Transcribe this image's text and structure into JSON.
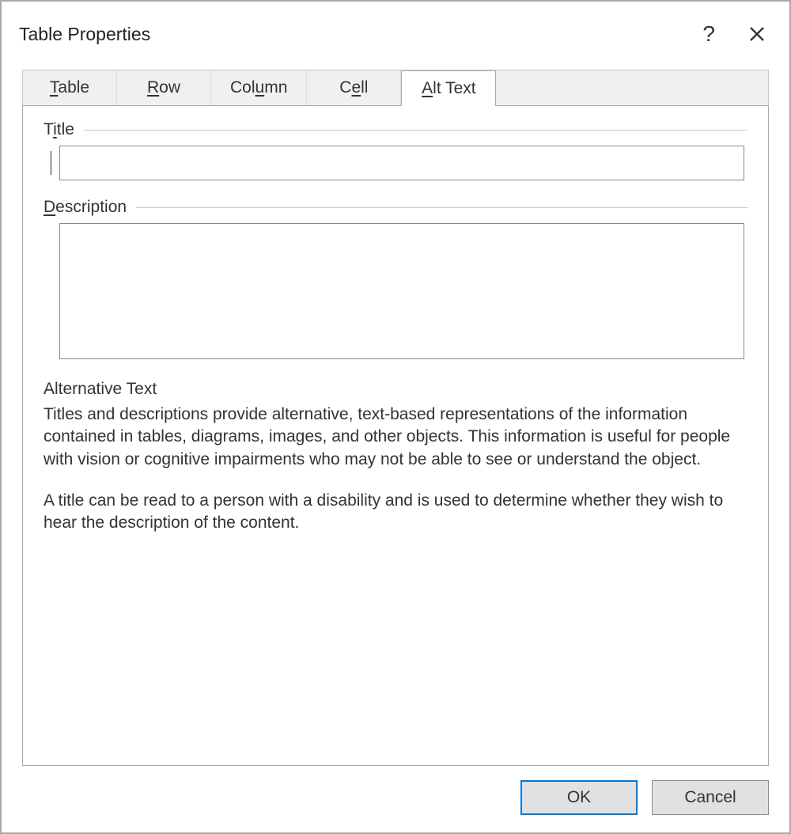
{
  "titlebar": {
    "title": "Table Properties",
    "help_glyph": "?",
    "close_label": "Close"
  },
  "tabs": [
    {
      "underline": "T",
      "rest": "able"
    },
    {
      "underline": "R",
      "rest": "ow"
    },
    {
      "pre": "Col",
      "underline": "u",
      "rest": "mn"
    },
    {
      "pre": "C",
      "underline": "e",
      "rest": "ll"
    },
    {
      "underline": "A",
      "rest": "lt Text",
      "active": true
    }
  ],
  "alt_text_panel": {
    "title_label": {
      "pre": "T",
      "underline": "i",
      "rest": "tle"
    },
    "title_value": "",
    "description_label": {
      "underline": "D",
      "rest": "escription"
    },
    "description_value": "",
    "section_heading": "Alternative Text",
    "paragraph1": "Titles and descriptions provide alternative, text-based representations of the information contained in tables, diagrams, images, and other objects. This information is useful for people with vision or cognitive impairments who may not be able to see or understand the object.",
    "paragraph2": "A title can be read to a person with a disability and is used to determine whether they wish to hear the description of the content."
  },
  "footer": {
    "ok_label": "OK",
    "cancel_label": "Cancel"
  }
}
